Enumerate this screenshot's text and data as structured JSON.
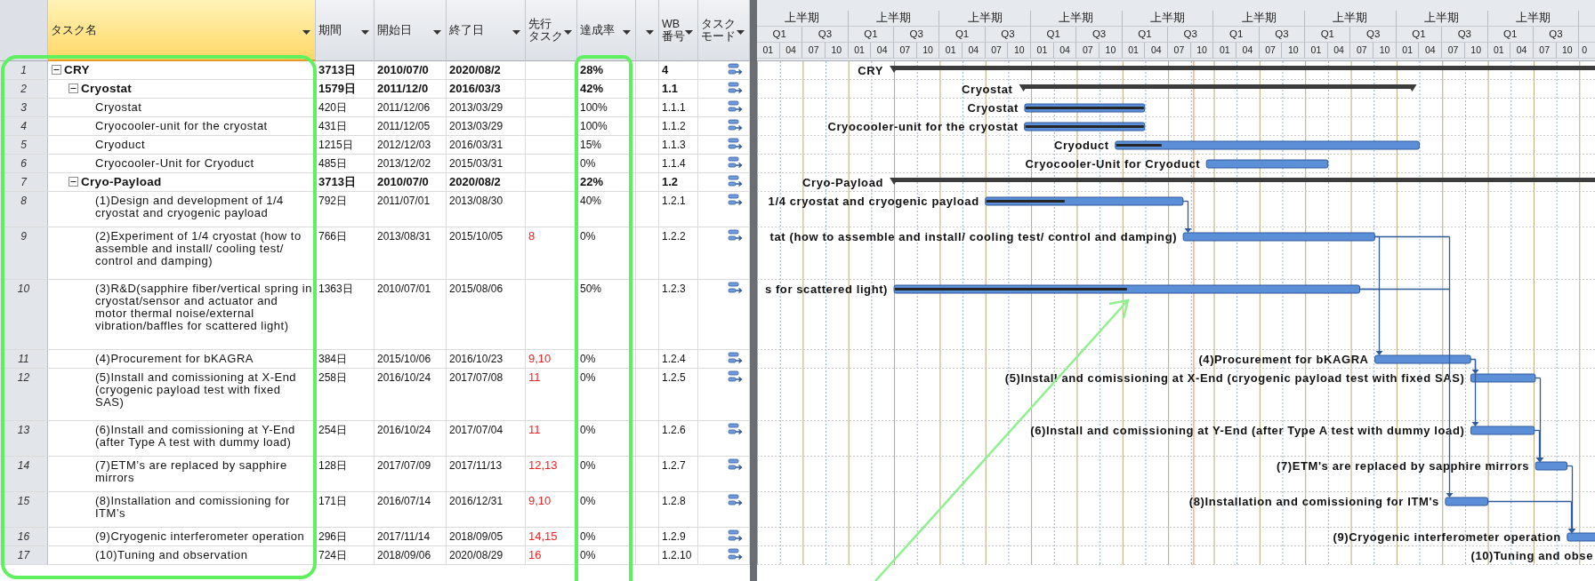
{
  "columns": [
    {
      "lines": [
        "タスク名"
      ],
      "selected": true
    },
    {
      "lines": [
        "期間"
      ],
      "selected": false
    },
    {
      "lines": [
        "開始日"
      ],
      "selected": false
    },
    {
      "lines": [
        "終了日"
      ],
      "selected": false
    },
    {
      "lines": [
        "先行",
        "タスク"
      ],
      "selected": false
    },
    {
      "lines": [
        "達成率"
      ],
      "selected": false
    },
    {
      "selected": false
    },
    {
      "lines": [
        "WB",
        "番号"
      ],
      "selected": false
    },
    {
      "lines": [
        "タスク",
        "モード"
      ],
      "selected": false
    }
  ],
  "timescale": {
    "years": [
      {
        "label": "上半期",
        "quarters": [
          "Q1",
          "Q3"
        ],
        "months": [
          "01",
          "04",
          "07",
          "10"
        ]
      },
      {
        "label": "上半期",
        "quarters": [
          "Q1",
          "Q3"
        ],
        "months": [
          "01",
          "04",
          "07",
          "10"
        ]
      },
      {
        "label": "上半期",
        "quarters": [
          "Q1",
          "Q3"
        ],
        "months": [
          "01",
          "04",
          "07",
          "10"
        ]
      },
      {
        "label": "上半期",
        "quarters": [
          "Q1",
          "Q3"
        ],
        "months": [
          "01",
          "04",
          "07",
          "10"
        ]
      },
      {
        "label": "上半期",
        "quarters": [
          "Q1",
          "Q3"
        ],
        "months": [
          "01",
          "04",
          "07",
          "10"
        ]
      },
      {
        "label": "上半期",
        "quarters": [
          "Q1",
          "Q3"
        ],
        "months": [
          "01",
          "04",
          "07",
          "10"
        ]
      },
      {
        "label": "上半期",
        "quarters": [
          "Q1",
          "Q3"
        ],
        "months": [
          "01",
          "04",
          "07",
          "10"
        ]
      },
      {
        "label": "上半期",
        "quarters": [
          "Q1",
          "Q3"
        ],
        "months": [
          "01",
          "04",
          "07",
          "10"
        ]
      },
      {
        "label": "上半期",
        "quarters": [
          "Q1",
          "Q3"
        ],
        "months": [
          "01",
          "04",
          "07",
          "10"
        ]
      }
    ],
    "cut_month": "0"
  },
  "tasks": [
    {
      "row": "1",
      "name": "CRY",
      "duration": "3713日",
      "start": "2010/07/0",
      "finish": "2020/08/2",
      "percent": "28%",
      "wbs": "4",
      "expanded": true,
      "gantt_label": "CRY",
      "children": [
        {
          "row": "2",
          "name": "Cryostat",
          "duration": "1579日",
          "start": "2011/12/0",
          "finish": "2016/03/3",
          "percent": "42%",
          "wbs": "1.1",
          "expanded": true,
          "gantt_label": "Cryostat",
          "children": [
            {
              "row": "3",
              "name": "Cryostat",
              "duration": "420日",
              "start": "2011/12/06",
              "finish": "2013/03/29",
              "percent": "100%",
              "wbs": "1.1.1",
              "gantt_label": "Cryostat"
            },
            {
              "row": "4",
              "name": "Cryocooler-unit for the cryostat",
              "duration": "431日",
              "start": "2011/12/05",
              "finish": "2013/03/29",
              "percent": "100%",
              "wbs": "1.1.2",
              "gantt_label": "Cryocooler-unit for the cryostat"
            },
            {
              "row": "5",
              "name": "Cryoduct",
              "duration": "1215日",
              "start": "2012/12/03",
              "finish": "2016/03/31",
              "percent": "15%",
              "wbs": "1.1.3",
              "gantt_label": "Cryoduct"
            },
            {
              "row": "6",
              "name": "Cryocooler-Unit for Cryoduct",
              "duration": "485日",
              "start": "2013/12/02",
              "finish": "2015/03/31",
              "percent": "0%",
              "wbs": "1.1.4",
              "gantt_label": "Cryocooler-Unit for Cryoduct"
            }
          ]
        },
        {
          "row": "7",
          "name": "Cryo-Payload",
          "duration": "3713日",
          "start": "2010/07/0",
          "finish": "2020/08/2",
          "percent": "22%",
          "wbs": "1.2",
          "expanded": true,
          "gantt_label": "Cryo-Payload",
          "children": [
            {
              "row": "8",
              "name": "(1)Design and development of 1/4 cryostat and cryogenic payload",
              "duration": "792日",
              "start": "2011/07/01",
              "finish": "2013/08/30",
              "percent": "40%",
              "wbs": "1.2.1",
              "gantt_label": "1/4 cryostat and cryogenic payload"
            },
            {
              "row": "9",
              "name": "(2)Experiment of 1/4 cryostat (how to assemble and install/ cooling test/ control and damping)",
              "duration": "766日",
              "start": "2013/08/31",
              "finish": "2015/10/05",
              "predecessors": "8",
              "percent": "0%",
              "wbs": "1.2.2",
              "gantt_label": "tat (how to assemble and install/ cooling test/ control and damping)"
            },
            {
              "row": "10",
              "name": "(3)R&D(sapphire fiber/vertical spring in cryostat/sensor and actuator and motor thermal noise/external vibration/baffles for scattered light)",
              "duration": "1363日",
              "start": "2010/07/01",
              "finish": "2015/08/06",
              "percent": "50%",
              "wbs": "1.2.3",
              "gantt_label": "s for scattered light)"
            },
            {
              "row": "11",
              "name": "(4)Procurement for bKAGRA",
              "duration": "384日",
              "start": "2015/10/06",
              "finish": "2016/10/23",
              "predecessors": "9,10",
              "percent": "0%",
              "wbs": "1.2.4",
              "gantt_label": "(4)Procurement for bKAGRA"
            },
            {
              "row": "12",
              "name": "(5)Install and comissioning at X-End (cryogenic payload test with fixed SAS)",
              "duration": "258日",
              "start": "2016/10/24",
              "finish": "2017/07/08",
              "predecessors": "11",
              "percent": "0%",
              "wbs": "1.2.5",
              "gantt_label": "(5)Install and comissioning at X-End (cryogenic payload test with fixed SAS)"
            },
            {
              "row": "13",
              "name": "(6)Install and comissioning at Y-End (after Type A test with dummy load)",
              "duration": "254日",
              "start": "2016/10/24",
              "finish": "2017/07/04",
              "predecessors": "11",
              "percent": "0%",
              "wbs": "1.2.6",
              "gantt_label": "(6)Install and comissioning at Y-End (after Type A test with dummy load)"
            },
            {
              "row": "14",
              "name": "(7)ETM’s are replaced by sapphire mirrors",
              "duration": "128日",
              "start": "2017/07/09",
              "finish": "2017/11/13",
              "predecessors": "12,13",
              "percent": "0%",
              "wbs": "1.2.7",
              "gantt_label": "(7)ETM's are replaced by sapphire mirrors"
            },
            {
              "row": "15",
              "name": "(8)Installation and comissioning for ITM’s",
              "duration": "171日",
              "start": "2016/07/14",
              "finish": "2016/12/31",
              "predecessors": "9,10",
              "percent": "0%",
              "wbs": "1.2.8",
              "gantt_label": "(8)Installation and comissioning for ITM's"
            },
            {
              "row": "16",
              "name": "(9)Cryogenic interferometer operation",
              "duration": "296日",
              "start": "2017/11/14",
              "finish": "2018/09/05",
              "predecessors": "14,15",
              "percent": "0%",
              "wbs": "1.2.9",
              "gantt_label": "(9)Cryogenic interferometer operation"
            },
            {
              "row": "17",
              "name": "(10)Tuning and observation",
              "duration": "724日",
              "start": "2018/09/06",
              "finish": "2020/08/29",
              "predecessors": "16",
              "percent": "0%",
              "wbs": "1.2.10",
              "gantt_label": "(10)Tuning and obse"
            }
          ]
        }
      ]
    }
  ]
}
